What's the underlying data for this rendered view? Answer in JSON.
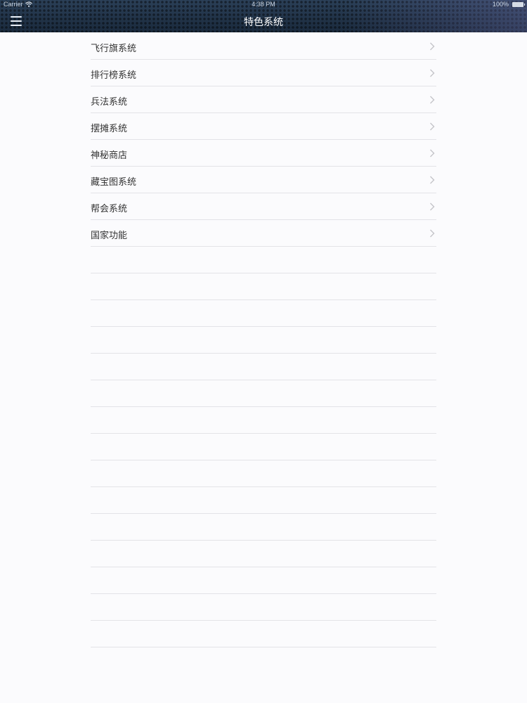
{
  "status_bar": {
    "carrier": "Carrier",
    "time": "4:38 PM",
    "battery": "100%"
  },
  "nav": {
    "title": "特色系统",
    "menu_icon": "hamburger-menu-icon"
  },
  "list": {
    "items": [
      {
        "label": "飞行旗系统"
      },
      {
        "label": "排行榜系统"
      },
      {
        "label": "兵法系统"
      },
      {
        "label": "摆摊系统"
      },
      {
        "label": "神秘商店"
      },
      {
        "label": "藏宝图系统"
      },
      {
        "label": "帮会系统"
      },
      {
        "label": "国家功能"
      }
    ],
    "empty_rows": 15,
    "row_icon": "chevron-right-icon"
  },
  "colors": {
    "nav_bar": "#1f2f44",
    "background": "#fbfbfd",
    "separator": "#e3e3e7",
    "chevron": "#c4c4c9"
  }
}
